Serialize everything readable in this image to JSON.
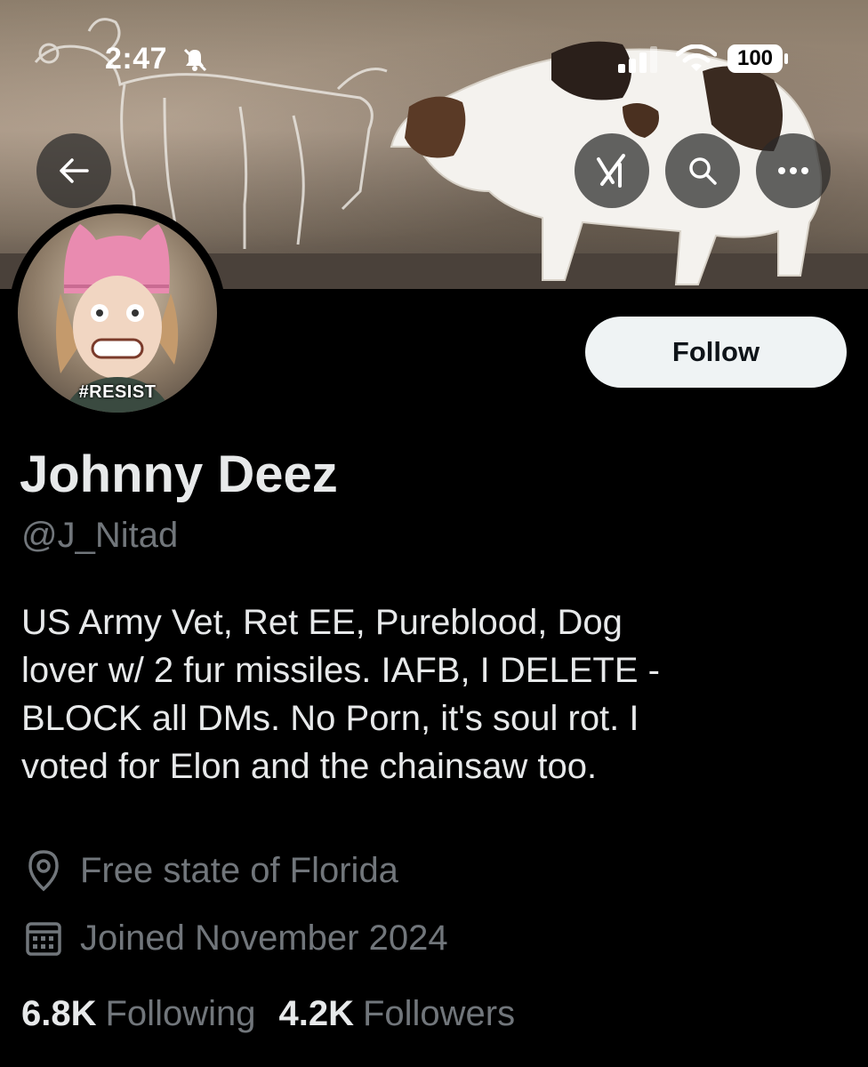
{
  "status_bar": {
    "time": "2:47",
    "battery": "100"
  },
  "header": {
    "back_icon": "arrow-left-icon",
    "grok_icon": "grok-icon",
    "search_icon": "search-icon",
    "more_icon": "more-dots-icon"
  },
  "avatar": {
    "label": "#RESIST"
  },
  "profile": {
    "follow_label": "Follow",
    "display_name": "Johnny Deez",
    "handle": "@J_Nitad",
    "bio_lines": [
      "US Army Vet, Ret EE, Pureblood, Dog",
      "lover w/ 2 fur missiles. IAFB, I DELETE -",
      "BLOCK all DMs. No Porn, it's soul rot. I",
      "voted for Elon and the chainsaw too."
    ],
    "location": "Free state of Florida",
    "joined": "Joined November 2024",
    "following_count": "6.8K",
    "following_label": "Following",
    "followers_count": "4.2K",
    "followers_label": "Followers"
  },
  "colors": {
    "background": "#000000",
    "text": "#e7e9ea",
    "muted": "#71767b",
    "button": "#eff3f4"
  }
}
